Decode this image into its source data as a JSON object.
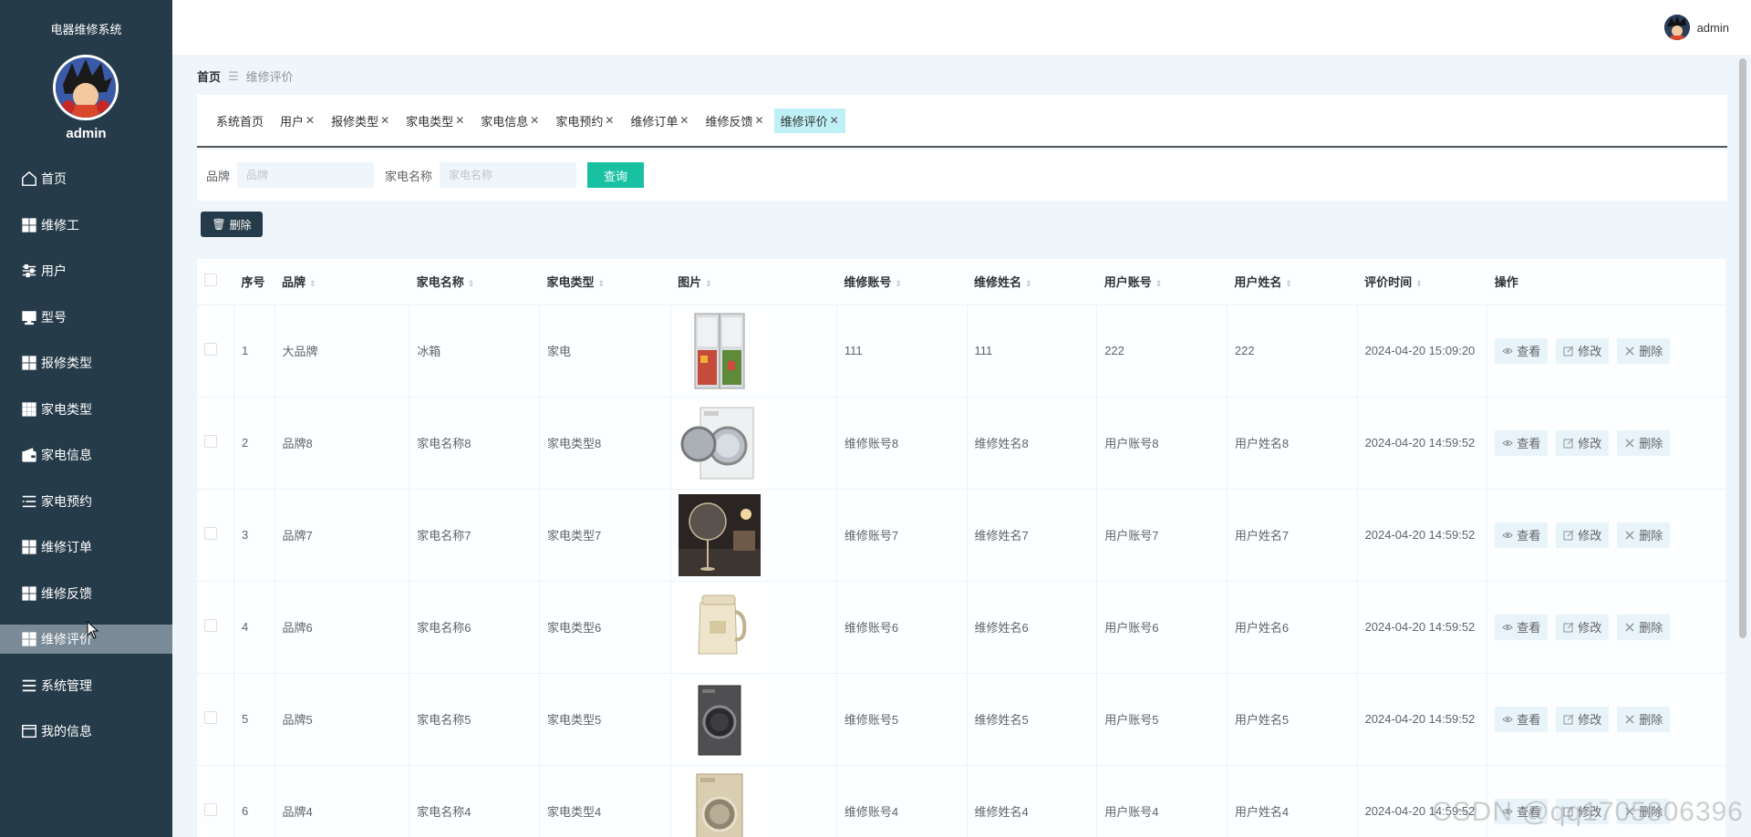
{
  "sidebar": {
    "app_title": "电器维修系统",
    "username": "admin",
    "menu": [
      {
        "label": "首页",
        "icon": "home-icon"
      },
      {
        "label": "维修工",
        "icon": "grid-icon"
      },
      {
        "label": "用户",
        "icon": "sliders-icon"
      },
      {
        "label": "型号",
        "icon": "monitor-icon"
      },
      {
        "label": "报修类型",
        "icon": "grid-icon"
      },
      {
        "label": "家电类型",
        "icon": "grid9-icon"
      },
      {
        "label": "家电信息",
        "icon": "wallet-icon"
      },
      {
        "label": "家电预约",
        "icon": "list-icon"
      },
      {
        "label": "维修订单",
        "icon": "grid-icon"
      },
      {
        "label": "维修反馈",
        "icon": "grid-icon"
      },
      {
        "label": "维修评价",
        "icon": "grid-icon",
        "active": true
      },
      {
        "label": "系统管理",
        "icon": "menu-icon"
      },
      {
        "label": "我的信息",
        "icon": "card-icon"
      }
    ]
  },
  "header": {
    "username": "admin"
  },
  "breadcrumb": {
    "home": "首页",
    "current": "维修评价"
  },
  "tabs": [
    {
      "label": "系统首页",
      "closable": false
    },
    {
      "label": "用户",
      "closable": true
    },
    {
      "label": "报修类型",
      "closable": true
    },
    {
      "label": "家电类型",
      "closable": true
    },
    {
      "label": "家电信息",
      "closable": true
    },
    {
      "label": "家电预约",
      "closable": true
    },
    {
      "label": "维修订单",
      "closable": true
    },
    {
      "label": "维修反馈",
      "closable": true
    },
    {
      "label": "维修评价",
      "closable": true,
      "active": true
    }
  ],
  "search": {
    "brand_label": "品牌",
    "brand_placeholder": "品牌",
    "name_label": "家电名称",
    "name_placeholder": "家电名称",
    "query_button": "查询"
  },
  "toolbar": {
    "delete_label": "删除"
  },
  "table": {
    "columns": [
      "序号",
      "品牌",
      "家电名称",
      "家电类型",
      "图片",
      "维修账号",
      "维修姓名",
      "用户账号",
      "用户姓名",
      "评价时间",
      "操作"
    ],
    "actions": {
      "view": "查看",
      "edit": "修改",
      "delete": "删除"
    },
    "rows": [
      {
        "index": "1",
        "brand": "大品牌",
        "name": "冰箱",
        "type": "家电",
        "image": "fridge",
        "repair_account": "111",
        "repair_name": "111",
        "user_account": "222",
        "user_name": "222",
        "time": "2024-04-20 15:09:20"
      },
      {
        "index": "2",
        "brand": "品牌8",
        "name": "家电名称8",
        "type": "家电类型8",
        "image": "washer-white",
        "repair_account": "维修账号8",
        "repair_name": "维修姓名8",
        "user_account": "用户账号8",
        "user_name": "用户姓名8",
        "time": "2024-04-20 14:59:52"
      },
      {
        "index": "3",
        "brand": "品牌7",
        "name": "家电名称7",
        "type": "家电类型7",
        "image": "fan",
        "repair_account": "维修账号7",
        "repair_name": "维修姓名7",
        "user_account": "用户账号7",
        "user_name": "用户姓名7",
        "time": "2024-04-20 14:59:52"
      },
      {
        "index": "4",
        "brand": "品牌6",
        "name": "家电名称6",
        "type": "家电类型6",
        "image": "blender",
        "repair_account": "维修账号6",
        "repair_name": "维修姓名6",
        "user_account": "用户账号6",
        "user_name": "用户姓名6",
        "time": "2024-04-20 14:59:52"
      },
      {
        "index": "5",
        "brand": "品牌5",
        "name": "家电名称5",
        "type": "家电类型5",
        "image": "washer-dark",
        "repair_account": "维修账号5",
        "repair_name": "维修姓名5",
        "user_account": "用户账号5",
        "user_name": "用户姓名5",
        "time": "2024-04-20 14:59:52"
      },
      {
        "index": "6",
        "brand": "品牌4",
        "name": "家电名称4",
        "type": "家电类型4",
        "image": "washer-gold",
        "repair_account": "维修账号4",
        "repair_name": "维修姓名4",
        "user_account": "用户账号4",
        "user_name": "用户姓名4",
        "time": "2024-04-20 14:59:52"
      }
    ]
  },
  "watermark": "CSDN @qq1705806396"
}
